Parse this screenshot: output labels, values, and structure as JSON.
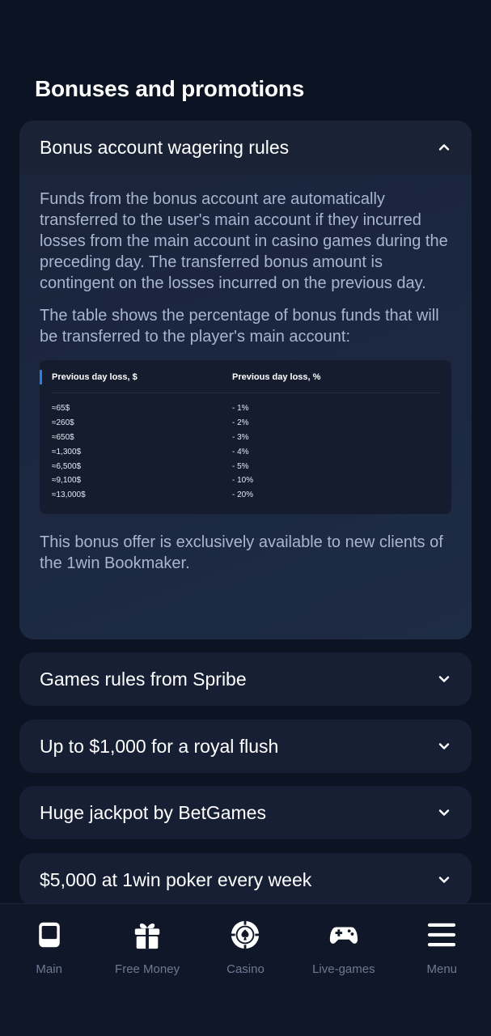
{
  "section_title": "Bonuses and promotions",
  "open_accordion": {
    "title": "Bonus account wagering rules",
    "paragraph1": "Funds from the bonus account are automatically transferred to the user's main account if they incurred losses from the main account in casino games during the preceding day. The transferred bonus amount is contingent on the losses incurred on the previous day.",
    "paragraph2": "The table shows the percentage of bonus funds that will be transferred to the player's main account:",
    "table": {
      "headers": [
        "Previous day loss,  $",
        "Previous day loss, %"
      ],
      "rows": [
        [
          "≈65$",
          "- 1%"
        ],
        [
          "≈260$",
          "- 2%"
        ],
        [
          "≈650$",
          "- 3%"
        ],
        [
          "≈1,300$",
          "- 4%"
        ],
        [
          "≈6,500$",
          "- 5%"
        ],
        [
          "≈9,100$",
          "- 10%"
        ],
        [
          "≈13,000$",
          "- 20%"
        ]
      ]
    },
    "paragraph3": "This bonus offer is exclusively available to new clients of the 1win Bookmaker."
  },
  "collapsed_accordions": [
    {
      "title": "Games rules from Spribe"
    },
    {
      "title": "Up to $1,000 for a royal flush"
    },
    {
      "title": "Huge jackpot by BetGames"
    },
    {
      "title": "$5,000 at 1win poker every week"
    }
  ],
  "bottom_nav": [
    {
      "label": "Main",
      "icon": "main-icon"
    },
    {
      "label": "Free Money",
      "icon": "gift-icon"
    },
    {
      "label": "Casino",
      "icon": "casino-chip-icon"
    },
    {
      "label": "Live-games",
      "icon": "gamepad-icon"
    },
    {
      "label": "Menu",
      "icon": "hamburger-menu-icon"
    }
  ],
  "colors": {
    "background": "#0c1323",
    "card": "#161f33",
    "text_primary": "#ffffff",
    "text_secondary": "#a9b4cf",
    "nav_label": "#6e7a95",
    "accent": "#2a7de1"
  }
}
